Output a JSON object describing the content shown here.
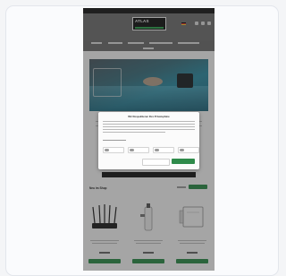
{
  "topbar": {
    "left": "",
    "right": ""
  },
  "logo": {
    "text": "ATLAS"
  },
  "modal": {
    "title": "Wir Respektieren Ihre Privatsphäre"
  },
  "section": {
    "title": "Neu im Shop"
  },
  "accent_color": "#2e8a4a",
  "products": [
    {
      "name": "router",
      "icon": "router-icon"
    },
    {
      "name": "outdoor-antenna",
      "icon": "antenna-icon"
    },
    {
      "name": "wall-panel",
      "icon": "panel-icon"
    }
  ]
}
